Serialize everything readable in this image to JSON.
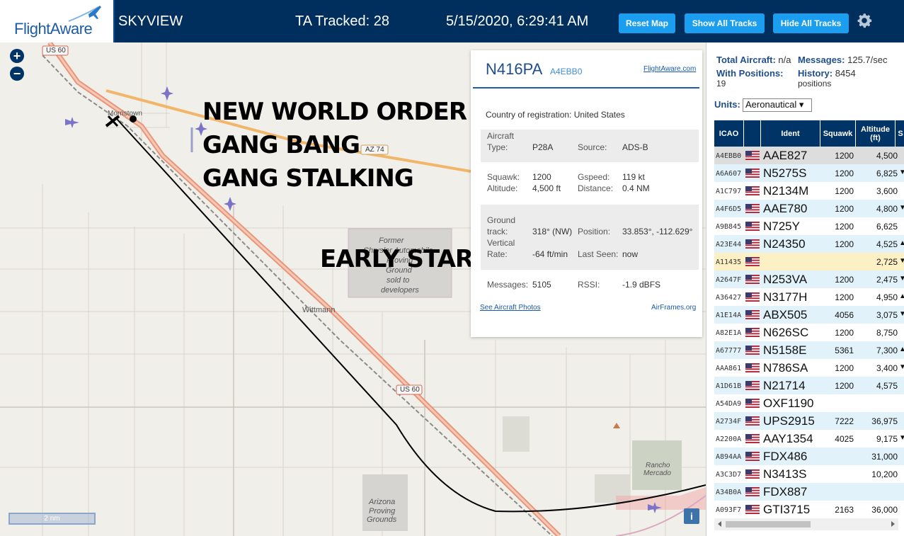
{
  "header": {
    "logo_text": "FlightAware",
    "title": "SKYVIEW",
    "ta_tracked": "TA Tracked: 28",
    "datetime": "5/15/2020, 6:29:41 AM",
    "buttons": {
      "reset": "Reset Map",
      "show_tracks": "Show All Tracks",
      "hide_tracks": "Hide All Tracks"
    }
  },
  "map": {
    "zoom_in": "+",
    "zoom_out": "−",
    "overlay": {
      "line1": "NEW WORLD ORDER",
      "line2": "GANG BANG",
      "line3": "GANG STALKING",
      "early": "EARLY START"
    },
    "labels": {
      "us60_top": "US 60",
      "az74": "AZ 74",
      "us60_mid": "US 60",
      "morristown": "Morristown",
      "wittmann": "Wittmann",
      "former1": "Former",
      "former2": "Chrysler Automobile",
      "former3": "Proving",
      "former4": "Ground",
      "former5": "sold to",
      "former6": "developers",
      "arizona1": "Arizona",
      "arizona2": "Proving",
      "arizona3": "Grounds",
      "rancho1": "Rancho",
      "rancho2": "Mercado"
    },
    "scale": "2 nm",
    "info": "i"
  },
  "popup": {
    "registration": "N416PA",
    "hex": "A4EBB0",
    "link": "FlightAware.com",
    "country_label": "Country of registration:",
    "country": "United States",
    "aircraft_type_label1": "Aircraft",
    "aircraft_type_label2": "Type:",
    "aircraft_type": "P28A",
    "source_label": "Source:",
    "source": "ADS-B",
    "squawk_label": "Squawk:",
    "squawk": "1200",
    "gspeed_label": "Gspeed:",
    "gspeed": "119 kt",
    "altitude_label": "Altitude:",
    "altitude": "4,500 ft",
    "distance_label": "Distance:",
    "distance": "0.4 NM",
    "ground_label1": "Ground",
    "ground_label2": "track:",
    "ground_track": "318° (NW)",
    "position_label": "Position:",
    "position": "33.853°, -112.629°",
    "vert_label1": "Vertical",
    "vert_label2": "Rate:",
    "vertical_rate": "-64 ft/min",
    "last_seen_label": "Last Seen:",
    "last_seen": "now",
    "messages_label": "Messages:",
    "messages": "5105",
    "rssi_label": "RSSI:",
    "rssi": "-1.9 dBFS",
    "photos_link": "See Aircraft Photos",
    "airframes_link": "AirFrames.org"
  },
  "sidebar": {
    "total_label": "Total Aircraft:",
    "total_value": "n/a",
    "messages_label": "Messages:",
    "messages_value": "125.7/sec",
    "positions_label": "With Positions:",
    "positions_value": "19",
    "history_label": "History:",
    "history_value": "8454",
    "history_unit": "positions",
    "units_label": "Units:",
    "units_value": "Aeronautical ▾",
    "columns": [
      "ICAO",
      "",
      "Ident",
      "Squawk",
      "Altitude (ft)",
      "S"
    ],
    "rows": [
      {
        "icao": "A4EBB0",
        "ident": "AAE827",
        "squawk": "1200",
        "alt": "4,500",
        "trend": ""
      },
      {
        "icao": "A6A607",
        "ident": "N5275S",
        "squawk": "1200",
        "alt": "6,825",
        "trend": "▼"
      },
      {
        "icao": "A1C797",
        "ident": "N2134M",
        "squawk": "1200",
        "alt": "3,600",
        "trend": ""
      },
      {
        "icao": "A4F6D5",
        "ident": "AAE780",
        "squawk": "1200",
        "alt": "4,800",
        "trend": "▼"
      },
      {
        "icao": "A9B845",
        "ident": "N725Y",
        "squawk": "1200",
        "alt": "6,625",
        "trend": ""
      },
      {
        "icao": "A23E44",
        "ident": "N24350",
        "squawk": "1200",
        "alt": "4,525",
        "trend": "▲"
      },
      {
        "icao": "A11435",
        "ident": "",
        "squawk": "",
        "alt": "2,725",
        "trend": "▼"
      },
      {
        "icao": "A2647F",
        "ident": "N253VA",
        "squawk": "1200",
        "alt": "2,475",
        "trend": "▼"
      },
      {
        "icao": "A36427",
        "ident": "N3177H",
        "squawk": "1200",
        "alt": "4,950",
        "trend": "▲"
      },
      {
        "icao": "A1E14A",
        "ident": "ABX505",
        "squawk": "4056",
        "alt": "3,075",
        "trend": "▼"
      },
      {
        "icao": "A82E1A",
        "ident": "N626SC",
        "squawk": "1200",
        "alt": "8,750",
        "trend": ""
      },
      {
        "icao": "A67777",
        "ident": "N5158E",
        "squawk": "5361",
        "alt": "7,300",
        "trend": "▲"
      },
      {
        "icao": "AAA861",
        "ident": "N786SA",
        "squawk": "1200",
        "alt": "3,400",
        "trend": "▼"
      },
      {
        "icao": "A1D61B",
        "ident": "N21714",
        "squawk": "1200",
        "alt": "4,575",
        "trend": ""
      },
      {
        "icao": "A54DA9",
        "ident": "OXF1190",
        "squawk": "",
        "alt": "",
        "trend": ""
      },
      {
        "icao": "A2734F",
        "ident": "UPS2915",
        "squawk": "7222",
        "alt": "36,975",
        "trend": ""
      },
      {
        "icao": "A2200A",
        "ident": "AAY1354",
        "squawk": "4025",
        "alt": "9,175",
        "trend": "▼"
      },
      {
        "icao": "A894AA",
        "ident": "FDX486",
        "squawk": "",
        "alt": "31,000",
        "trend": ""
      },
      {
        "icao": "A3C3D7",
        "ident": "N3413S",
        "squawk": "",
        "alt": "10,200",
        "trend": ""
      },
      {
        "icao": "A34B0A",
        "ident": "FDX887",
        "squawk": "",
        "alt": "",
        "trend": ""
      },
      {
        "icao": "A093F7",
        "ident": "GTI3715",
        "squawk": "2163",
        "alt": "36,000",
        "trend": ""
      }
    ]
  },
  "colors": {
    "header_bg": "#002f5d",
    "accent": "#1c9ef0",
    "table_head": "#003466",
    "row_alt": "#e2f2fb",
    "highlight": "#fdf0c4"
  }
}
